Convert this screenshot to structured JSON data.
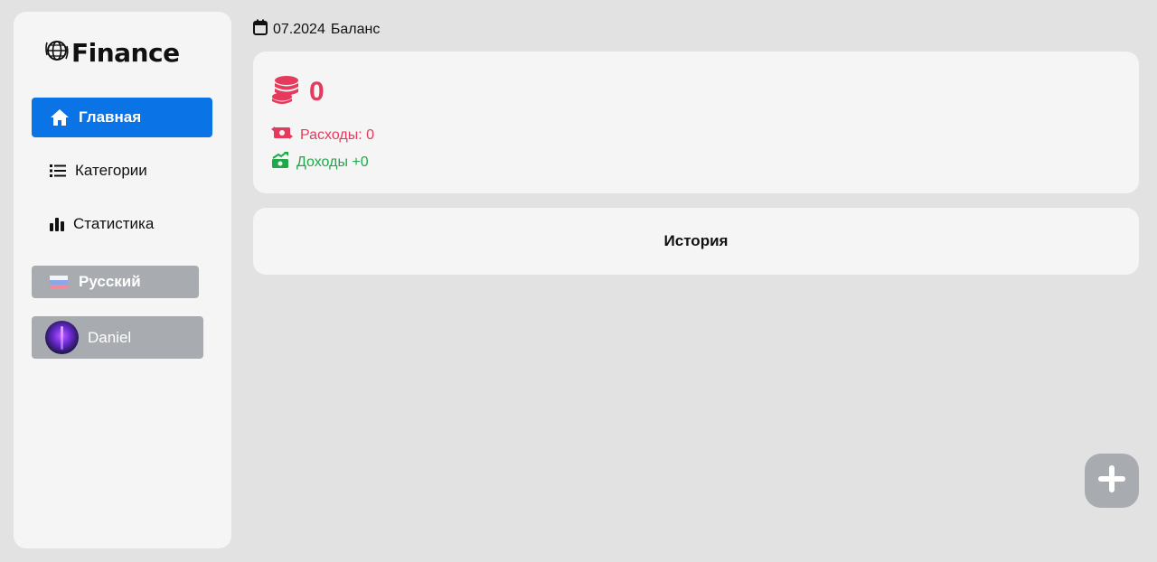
{
  "app": {
    "logo_text": "Finance"
  },
  "sidebar": {
    "items": [
      {
        "label": "Главная",
        "icon": "home-icon",
        "active": true
      },
      {
        "label": "Категории",
        "icon": "list-icon",
        "active": false
      },
      {
        "label": "Статистика",
        "icon": "bar-chart-icon",
        "active": false
      }
    ],
    "language": {
      "label": "Русский",
      "flag": "ru-flag-icon"
    },
    "user": {
      "name": "Daniel"
    }
  },
  "header": {
    "date": "07.2024",
    "title": "Баланс"
  },
  "balance": {
    "value": "0",
    "expenses_label": "Расходы: 0",
    "income_label": "Доходы +0"
  },
  "history": {
    "title": "История"
  },
  "colors": {
    "accent": "#0a74e6",
    "expense": "#e63a5c",
    "income": "#1fa84a",
    "muted_button": "#a8acb0",
    "card": "#f5f5f5",
    "background": "#e2e2e2"
  },
  "fab": {
    "icon": "plus-icon"
  }
}
